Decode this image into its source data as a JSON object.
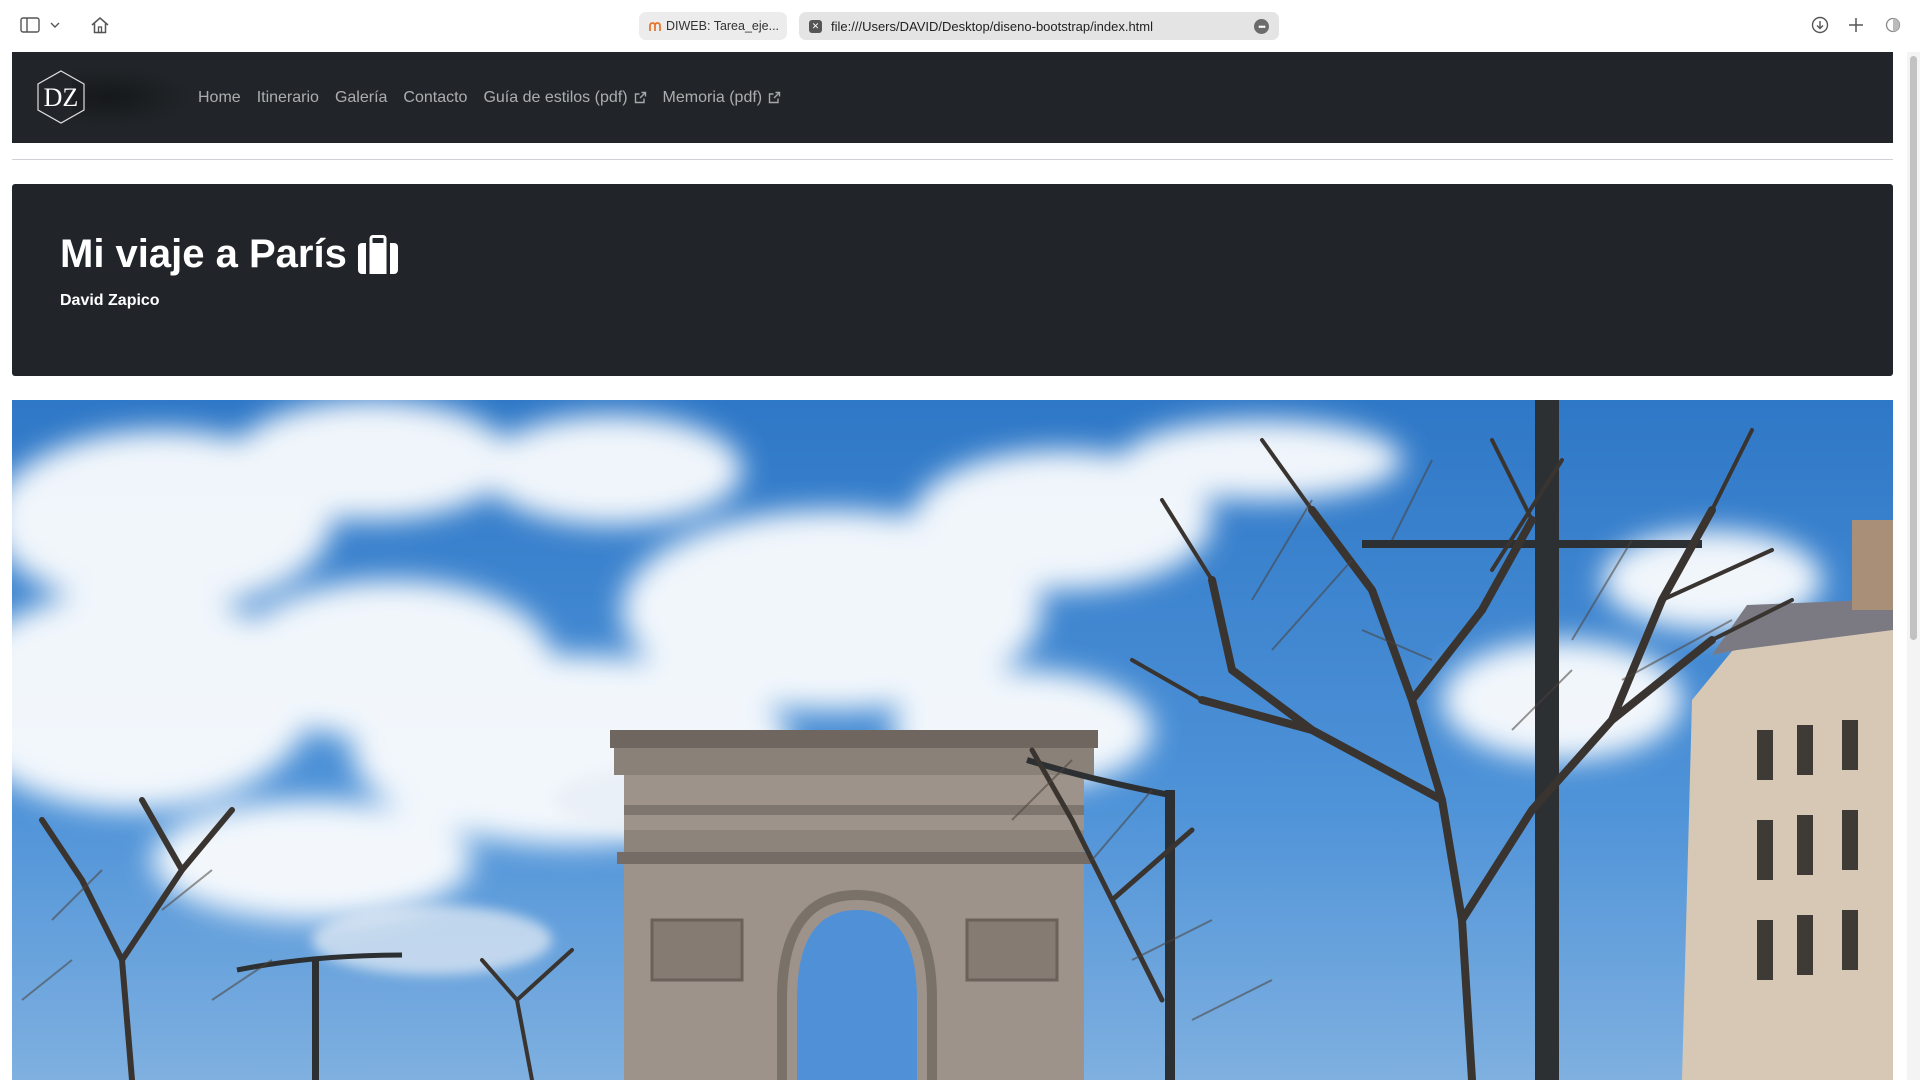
{
  "browser": {
    "tabs": [
      {
        "title": "DIWEB: Tarea_eje...",
        "active": false
      },
      {
        "title": "file:///Users/DAVID/Desktop/diseno-bootstrap/index.html",
        "active": true
      }
    ],
    "icons": [
      "sidebar-toggle-icon",
      "chevron-down-icon",
      "home-icon",
      "download-icon",
      "plus-icon",
      "reader-icon"
    ]
  },
  "navbar": {
    "logo_text": "DZ",
    "links": [
      {
        "label": "Home",
        "external": false
      },
      {
        "label": "Itinerario",
        "external": false
      },
      {
        "label": "Galería",
        "external": false
      },
      {
        "label": "Contacto",
        "external": false
      },
      {
        "label": "Guía de estilos (pdf)",
        "external": true
      },
      {
        "label": "Memoria (pdf)",
        "external": true
      }
    ]
  },
  "hero": {
    "title": "Mi viaje a París",
    "title_icon": "suitcase-icon",
    "author": "David Zapico"
  },
  "colors": {
    "dark": "#212529",
    "nav_text": "#a6a8aa",
    "sky": "#3f86d0"
  }
}
